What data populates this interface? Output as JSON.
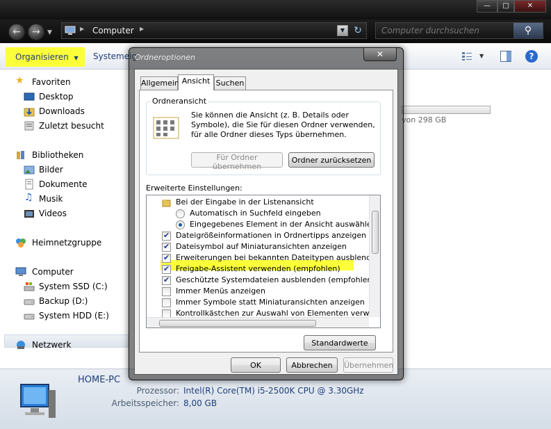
{
  "window": {
    "buttons": {
      "minimize": "—",
      "maximize": "□",
      "close": "✕"
    }
  },
  "address": {
    "path": "Computer",
    "search_placeholder": "Computer durchsuchen"
  },
  "toolbar": {
    "organize_label": "Organisieren",
    "system_label": "Systemeig"
  },
  "sidebar": {
    "favorites": {
      "header": "Favoriten",
      "items": [
        "Desktop",
        "Downloads",
        "Zuletzt besucht"
      ]
    },
    "libraries": {
      "header": "Bibliotheken",
      "items": [
        "Bilder",
        "Dokumente",
        "Musik",
        "Videos"
      ]
    },
    "homegroup": "Heimnetzgruppe",
    "computer": {
      "header": "Computer",
      "items": [
        "System SSD (C:)",
        "Backup (D:)",
        "System HDD (E:)"
      ]
    },
    "network": "Netzwerk"
  },
  "main": {
    "drive_free_text": "von 298 GB"
  },
  "details": {
    "computer_name": "HOME-PC",
    "processor_label": "Prozessor:",
    "processor_value": "Intel(R) Core(TM) i5-2500K CPU @ 3.30GHz",
    "memory_label": "Arbeitsspeicher:",
    "memory_value": "8,00 GB"
  },
  "dialog": {
    "title": "Ordneroptionen",
    "close": "✕",
    "tabs": [
      "Allgemein",
      "Ansicht",
      "Suchen"
    ],
    "active_tab": "Ansicht",
    "view_group": {
      "title": "Ordneransicht",
      "description": "Sie können die Ansicht (z. B. Details oder Symbole), die Sie für diesen Ordner verwenden, für alle Ordner dieses Typs übernehmen.",
      "apply_button": "Für Ordner übernehmen",
      "reset_button": "Ordner zurücksetzen"
    },
    "advanced_label": "Erweiterte Einstellungen:",
    "settings": [
      {
        "type": "folder",
        "indent": 1,
        "label": "Bei der Eingabe in der Listenansicht",
        "checked": false
      },
      {
        "type": "radio",
        "indent": 2,
        "label": "Automatisch in Suchfeld eingeben",
        "checked": false
      },
      {
        "type": "radio",
        "indent": 2,
        "label": "Eingegebenes Element in der Ansicht auswählen",
        "checked": true
      },
      {
        "type": "checkbox",
        "indent": 1,
        "label": "Dateigrößeinformationen in Ordnertipps anzeigen",
        "checked": true
      },
      {
        "type": "checkbox",
        "indent": 1,
        "label": "Dateisymbol auf Miniaturansichten anzeigen",
        "checked": true
      },
      {
        "type": "checkbox",
        "indent": 1,
        "label": "Erweiterungen bei bekannten Dateitypen ausblenden",
        "checked": true
      },
      {
        "type": "checkbox",
        "indent": 1,
        "label": "Freigabe-Assistent verwenden (empfohlen)",
        "checked": true
      },
      {
        "type": "checkbox",
        "indent": 1,
        "label": "Geschützte Systemdateien ausblenden (empfohlen)",
        "checked": true
      },
      {
        "type": "checkbox",
        "indent": 1,
        "label": "Immer Menüs anzeigen",
        "checked": false
      },
      {
        "type": "checkbox",
        "indent": 1,
        "label": "Immer Symbole statt Miniaturansichten anzeigen",
        "checked": false
      },
      {
        "type": "checkbox",
        "indent": 1,
        "label": "Kontrollkästchen zur Auswahl von Elementen verwenden",
        "checked": false
      }
    ],
    "defaults_button": "Standardwerte",
    "ok_button": "OK",
    "cancel_button": "Abbrechen",
    "apply_button": "Übernehmen"
  },
  "colors": {
    "highlight": "#fbff3a",
    "link_blue": "#1e3e79",
    "dark_chrome": "#1a1a1a"
  }
}
